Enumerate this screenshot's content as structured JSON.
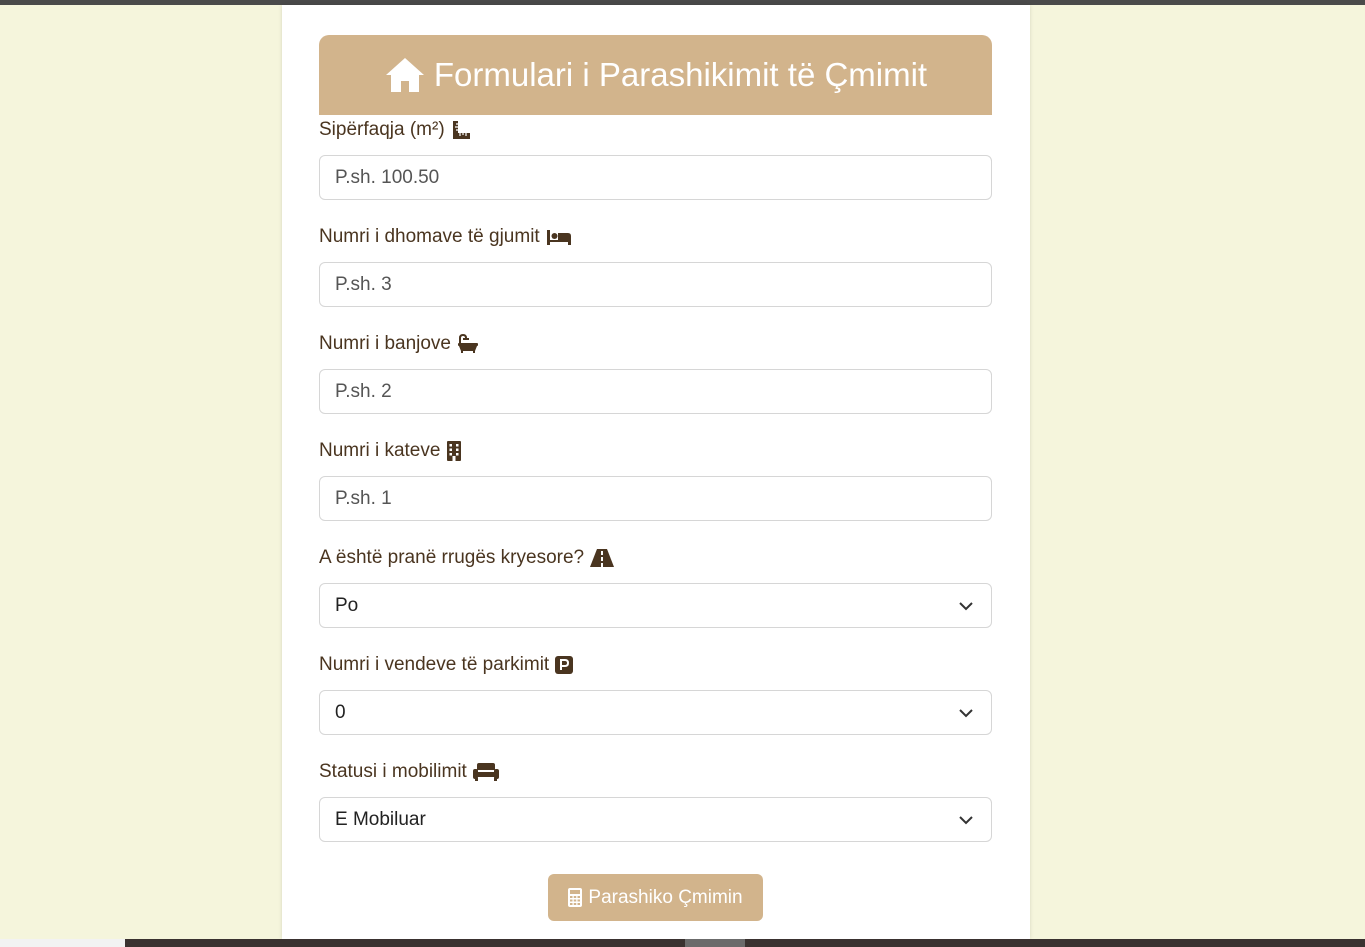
{
  "form": {
    "title": "Formulari i Parashikimit të Çmimit",
    "title_icon": "home-icon",
    "fields": [
      {
        "label": "Sipërfaqja (m²)",
        "icon": "ruler-icon",
        "type": "input",
        "placeholder": "P.sh. 100.50"
      },
      {
        "label": "Numri i dhomave të gjumit",
        "icon": "bed-icon",
        "type": "input",
        "placeholder": "P.sh. 3"
      },
      {
        "label": "Numri i banjove",
        "icon": "bath-icon",
        "type": "input",
        "placeholder": "P.sh. 2"
      },
      {
        "label": "Numri i kateve",
        "icon": "building-icon",
        "type": "input",
        "placeholder": "P.sh. 1"
      },
      {
        "label": "A është pranë rrugës kryesore?",
        "icon": "road-icon",
        "type": "select",
        "value": "Po"
      },
      {
        "label": "Numri i vendeve të parkimit",
        "icon": "parking-icon",
        "type": "select",
        "value": "0"
      },
      {
        "label": "Statusi i mobilimit",
        "icon": "couch-icon",
        "type": "select",
        "value": "E Mobiluar"
      }
    ],
    "submit_label": "Parashiko Çmimin",
    "submit_icon": "calculator-icon"
  },
  "colors": {
    "page_background": "#f5f5dc",
    "accent": "#d2b48c",
    "label_text": "#4a3520"
  }
}
